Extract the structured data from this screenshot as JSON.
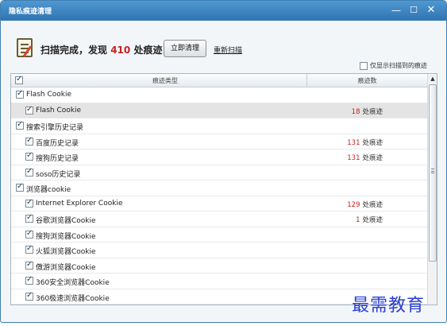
{
  "window": {
    "title": "隐私痕迹清理",
    "min_icon": "—",
    "max_icon": "☐",
    "close_icon": "✕"
  },
  "header": {
    "scan_prefix": "扫描完成，发现",
    "scan_count": "410",
    "scan_suffix": "处痕迹",
    "clean_button": "立即清理",
    "rescan_link": "重新扫描"
  },
  "filter": {
    "label": "仅显示扫描到的痕迹",
    "checked": false
  },
  "table": {
    "columns": [
      "痕迹类型",
      "痕迹数"
    ],
    "rows": [
      {
        "name": "Flash Cookie",
        "level": 0,
        "checked": true,
        "count": "",
        "unit": ""
      },
      {
        "name": "Flash Cookie",
        "level": 1,
        "checked": true,
        "count": "18",
        "unit": "处痕迹",
        "selected": true
      },
      {
        "name": "搜索引擎历史记录",
        "level": 0,
        "checked": true,
        "count": "",
        "unit": ""
      },
      {
        "name": "百度历史记录",
        "level": 1,
        "checked": true,
        "count": "131",
        "unit": "处痕迹"
      },
      {
        "name": "搜狗历史记录",
        "level": 1,
        "checked": true,
        "count": "131",
        "unit": "处痕迹"
      },
      {
        "name": "soso历史记录",
        "level": 1,
        "checked": true,
        "count": "",
        "unit": ""
      },
      {
        "name": "浏览器cookie",
        "level": 0,
        "checked": true,
        "count": "",
        "unit": ""
      },
      {
        "name": "Internet Explorer Cookie",
        "level": 1,
        "checked": true,
        "count": "129",
        "unit": "处痕迹"
      },
      {
        "name": "谷歌浏览器Cookie",
        "level": 1,
        "checked": true,
        "count": "1",
        "unit": "处痕迹"
      },
      {
        "name": "搜狗浏览器Cookie",
        "level": 1,
        "checked": true,
        "count": "",
        "unit": ""
      },
      {
        "name": "火狐浏览器Cookie",
        "level": 1,
        "checked": true,
        "count": "",
        "unit": ""
      },
      {
        "name": "傲游浏览器Cookie",
        "level": 1,
        "checked": true,
        "count": "",
        "unit": ""
      },
      {
        "name": "360安全浏览器Cookie",
        "level": 1,
        "checked": true,
        "count": "",
        "unit": ""
      },
      {
        "name": "360极速浏览器Cookie",
        "level": 1,
        "checked": true,
        "count": "",
        "unit": ""
      }
    ]
  },
  "scrollbar": {
    "up_arrow": "▲"
  },
  "watermark": {
    "text": "最需教育"
  },
  "colors": {
    "titlebar": "#3a84c1",
    "accent_count": "#c8211e",
    "watermark": "#2a3fd1"
  }
}
